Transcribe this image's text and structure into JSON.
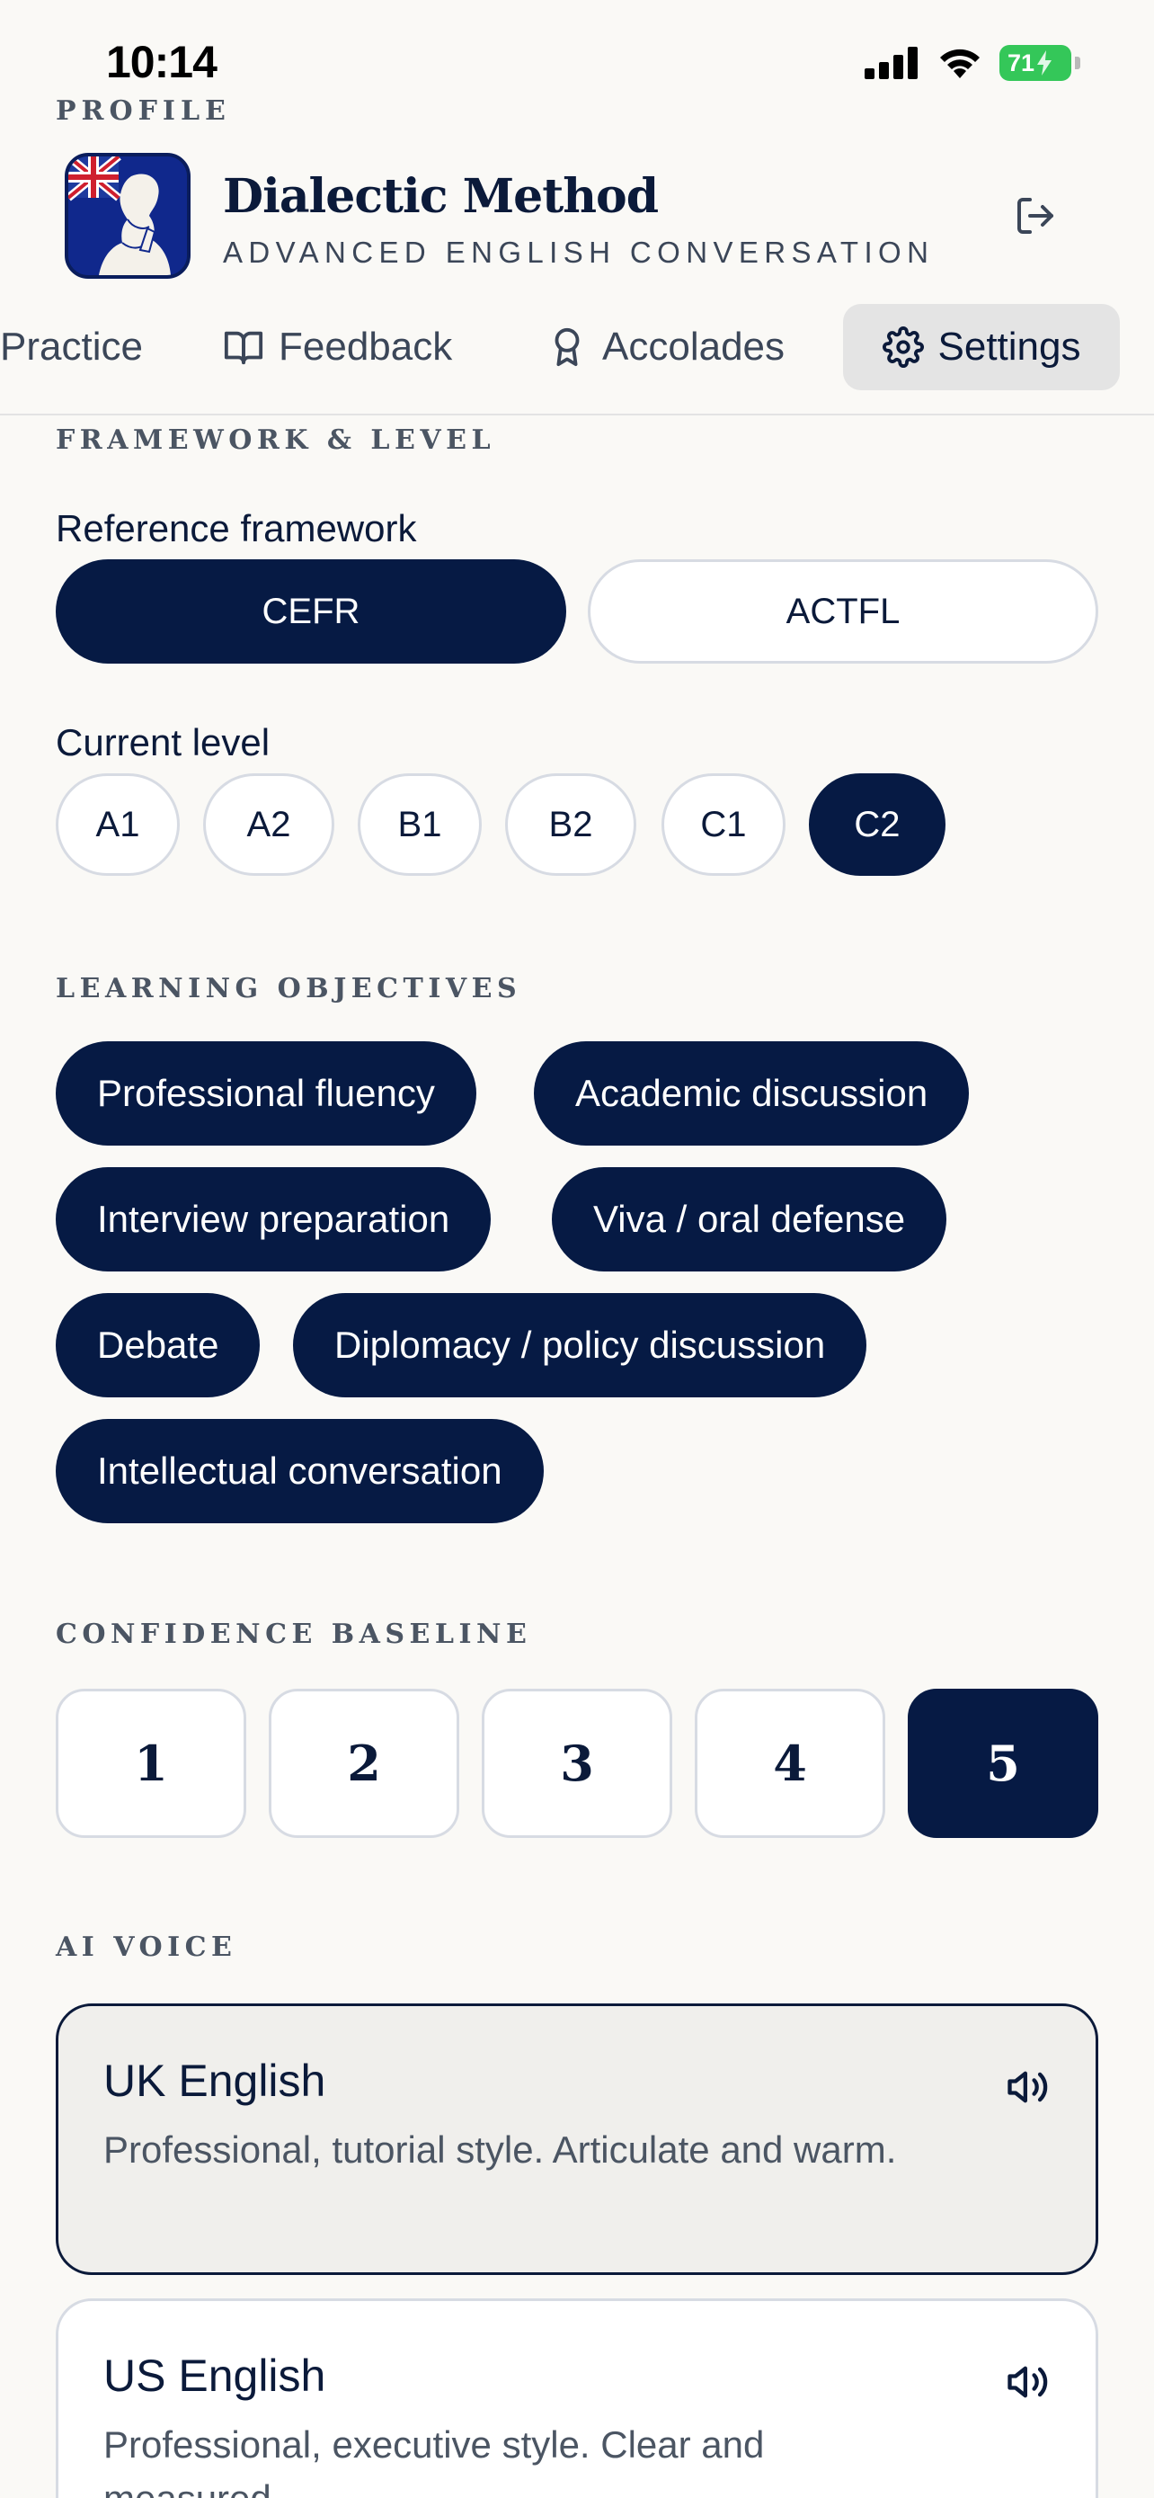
{
  "status_bar": {
    "time": "10:14",
    "battery": "71"
  },
  "header": {
    "section_label": "PROFILE",
    "app_name": "Dialectic Method",
    "app_subtitle": "ADVANCED ENGLISH CONVERSATION"
  },
  "tabs": [
    {
      "label": "Practice",
      "icon": "practice-icon"
    },
    {
      "label": "Feedback",
      "icon": "book-icon"
    },
    {
      "label": "Accolades",
      "icon": "award-icon"
    },
    {
      "label": "Settings",
      "icon": "gear-icon",
      "active": true
    }
  ],
  "framework": {
    "section_label": "FRAMEWORK & LEVEL",
    "reference_label": "Reference framework",
    "options": [
      "CEFR",
      "ACTFL"
    ],
    "selected": "CEFR",
    "level_label": "Current level",
    "levels": [
      "A1",
      "A2",
      "B1",
      "B2",
      "C1",
      "C2"
    ],
    "selected_level": "C2"
  },
  "objectives": {
    "section_label": "LEARNING OBJECTIVES",
    "items": [
      "Professional fluency",
      "Academic discussion",
      "Interview preparation",
      "Viva / oral defense",
      "Debate",
      "Diplomacy / policy discussion",
      "Intellectual conversation"
    ]
  },
  "confidence": {
    "section_label": "CONFIDENCE BASELINE",
    "values": [
      "1",
      "2",
      "3",
      "4",
      "5"
    ],
    "selected": "5"
  },
  "voice": {
    "section_label": "AI VOICE",
    "options": [
      {
        "name": "UK English",
        "description": "Professional, tutorial style. Articulate and warm.",
        "selected": true
      },
      {
        "name": "US English",
        "description": "Professional, executive style. Clear and measured.",
        "selected": false
      }
    ]
  },
  "colors": {
    "accent": "#061a44",
    "background": "#faf9f6",
    "battery": "#34c759"
  }
}
